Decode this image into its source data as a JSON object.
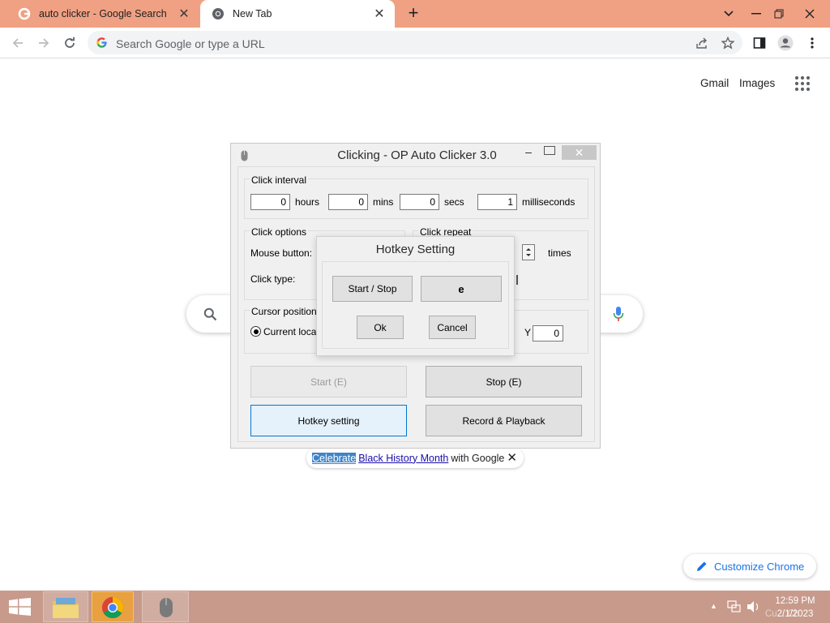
{
  "browser": {
    "tabs": [
      {
        "title": "auto clicker - Google Search",
        "active": false
      },
      {
        "title": "New Tab",
        "active": true
      }
    ],
    "omnibox": {
      "placeholder": "Search Google or type a URL"
    }
  },
  "ntp": {
    "header_links": [
      "Gmail",
      "Images"
    ],
    "promo": {
      "highlight": "Celebrate",
      "link": "Black History Month",
      "rest": "with Google"
    },
    "customize_label": "Customize Chrome"
  },
  "autoclicker": {
    "title": "Clicking - OP Auto Clicker 3.0",
    "click_interval": {
      "label": "Click interval",
      "fields": [
        {
          "value": "0",
          "unit": "hours"
        },
        {
          "value": "0",
          "unit": "mins"
        },
        {
          "value": "0",
          "unit": "secs"
        },
        {
          "value": "1",
          "unit": "milliseconds"
        }
      ]
    },
    "click_options": {
      "label": "Click options",
      "mouse_button_label": "Mouse button:",
      "click_type_label": "Click type:"
    },
    "click_repeat": {
      "label": "Click repeat",
      "times_label": "times"
    },
    "cursor_position": {
      "label": "Cursor position",
      "current_location_label": "Current locatio",
      "y_label": "Y",
      "y_value": "0"
    },
    "buttons": {
      "start": "Start (E)",
      "stop": "Stop (E)",
      "hotkey": "Hotkey setting",
      "record": "Record & Playback"
    }
  },
  "hotkey_dialog": {
    "title": "Hotkey Setting",
    "start_stop_label": "Start / Stop",
    "key_value": "e",
    "ok_label": "Ok",
    "cancel_label": "Cancel"
  },
  "taskbar": {
    "time": "12:59 PM",
    "date": "2/1/2023",
    "overlay_text": "Cu... Ch"
  },
  "colors": {
    "tabstrip": "#f0a183",
    "taskbar": "#c79a8b",
    "link": "#1a73e8"
  }
}
